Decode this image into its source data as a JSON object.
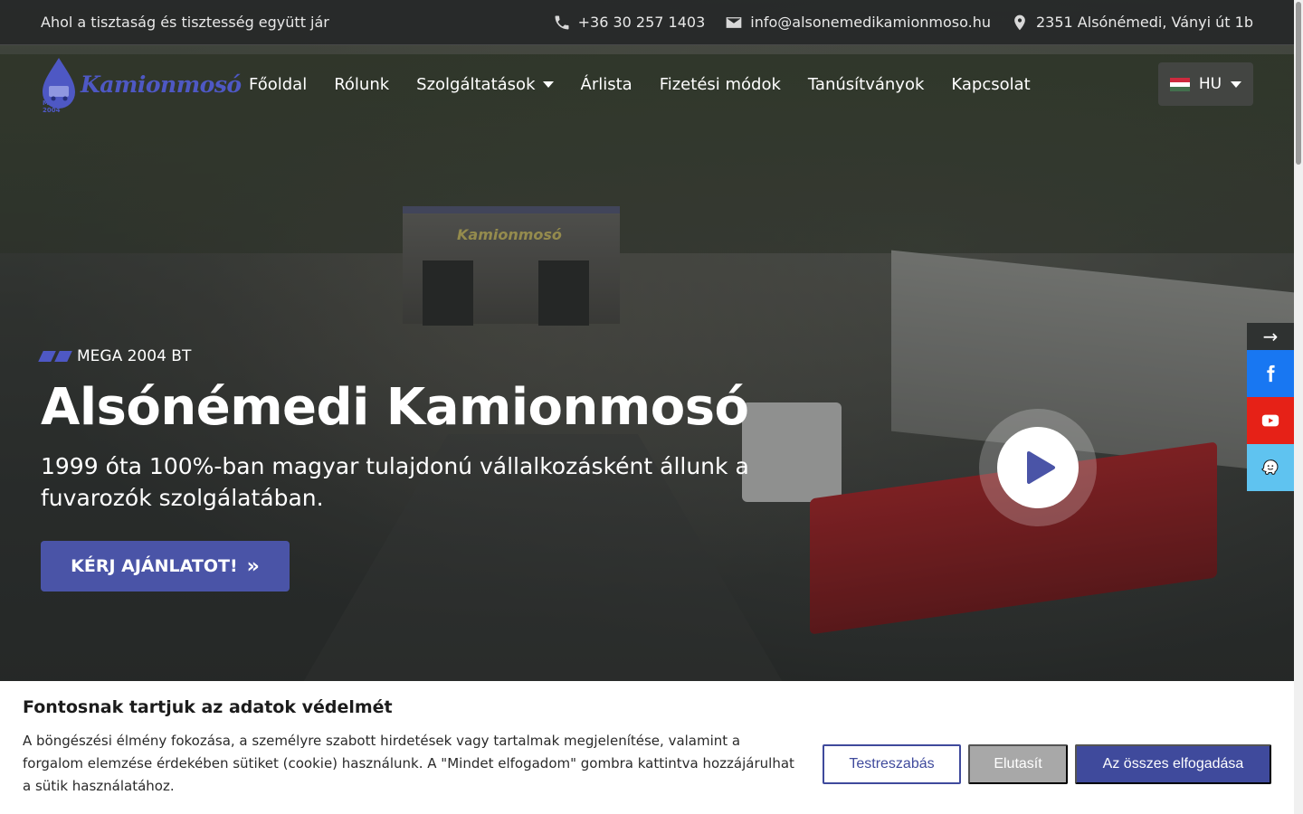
{
  "topbar": {
    "tagline": "Ahol a tisztaság és tisztesség együtt jár",
    "phone": "+36 30 257 1403",
    "email": "info@alsonemedikamionmoso.hu",
    "address": "2351 Alsónémedi, Ványi út 1b"
  },
  "logo": {
    "text": "Kamionmosó",
    "sub": "MEGA 2004"
  },
  "nav": {
    "items": [
      {
        "label": "Főoldal"
      },
      {
        "label": "Rólunk"
      },
      {
        "label": "Szolgáltatások"
      },
      {
        "label": "Árlista"
      },
      {
        "label": "Fizetési módok"
      },
      {
        "label": "Tanúsítványok"
      },
      {
        "label": "Kapcsolat"
      }
    ],
    "language": "HU"
  },
  "hero": {
    "eyebrow": "MEGA 2004 BT",
    "title": "Alsónémedi Kamionmosó",
    "subtitle": "1999 óta 100%-ban magyar tulajdonú vállalkozásként állunk a fuvarozók szolgálatában.",
    "cta": "KÉRJ AJÁNLATOT!",
    "building_sign": "Kamionmosó"
  },
  "social": {
    "toggle": "→"
  },
  "cookie": {
    "title": "Fontosnak tartjuk az adatok védelmét",
    "text": "A böngészési élmény fokozása, a személyre szabott hirdetések vagy tartalmak megjelenítése, valamint a forgalom elemzése érdekében sütiket (cookie) használunk. A \"Mindet elfogadom\" gombra kattintva hozzájárulhat a sütik használatához.",
    "customize": "Testreszabás",
    "reject": "Elutasít",
    "accept": "Az összes elfogadása"
  },
  "colors": {
    "brand": "#4a54a7",
    "facebook": "#1877f2",
    "youtube": "#e62117",
    "waze": "#5fc3f0"
  }
}
